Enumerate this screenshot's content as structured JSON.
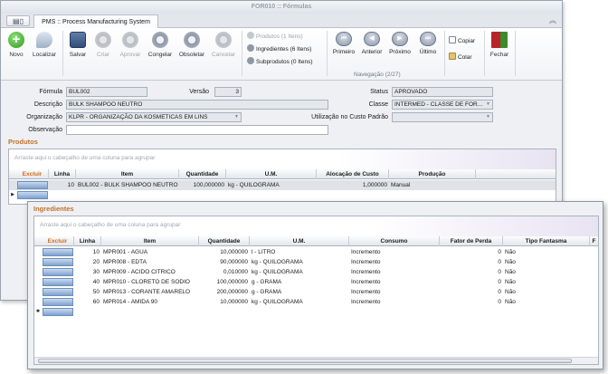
{
  "window": {
    "title": "FOR010 :: Fórmulas",
    "tab": "PMS :: Process Manufacturing System"
  },
  "toolbar": {
    "novo": "Novo",
    "localizar": "Localizar",
    "salvar": "Salvar",
    "criar": "Criar",
    "aprovar": "Aprovar",
    "congelar": "Congelar",
    "obsoletar": "Obsoletar",
    "cancelar": "Cancelar",
    "produtos": "Produtos (1 Itens)",
    "ingredientes": "Ingredientes (6 Itens)",
    "subprodutos": "Subprodutos (0 Itens)",
    "primeiro": "Primeiro",
    "anterior": "Anterior",
    "proximo": "Próximo",
    "ultimo": "Último",
    "navegacao": "Navegação (2/27)",
    "copiar": "Copiar",
    "colar": "Colar",
    "fechar": "Fechar"
  },
  "form": {
    "formula_label": "Fórmula",
    "formula_value": "BUL002",
    "versao_label": "Versão",
    "versao_value": "3",
    "descricao_label": "Descrição",
    "descricao_value": "BULK SHAMPOO NEUTRO",
    "organizacao_label": "Organização",
    "organizacao_value": "KLPR - ORGANIZAÇÃO DA KOSMETICAS EM LINS",
    "observacao_label": "Observação",
    "observacao_value": "",
    "status_label": "Status",
    "status_value": "APROVADO",
    "classe_label": "Classe",
    "classe_value": "INTERMED - CLASSE DE FOR...",
    "utilizacao_label": "Utilização no Custo Padrão",
    "utilizacao_value": ""
  },
  "produtos": {
    "title": "Produtos",
    "group_hint": "Arraste aqui o cabeçalho de uma coluna para agrupar",
    "columns": [
      "Excluir",
      "Linha",
      "Item",
      "Quantidade",
      "U.M.",
      "Alocação de Custo",
      "Produção"
    ],
    "rows": [
      {
        "linha": "10",
        "item": "BUL002 - BULK SHAMPOO NEUTRO",
        "quantidade": "100,000000",
        "um": "kg - QUILOGRAMA",
        "alocacao": "1,000000",
        "producao": "Manual"
      }
    ]
  },
  "ingredientes": {
    "title": "Ingredientes",
    "group_hint": "Arraste aqui o cabeçalho de uma coluna para agrupar",
    "columns": [
      "Excluir",
      "Linha",
      "Item",
      "Quantidade",
      "U.M.",
      "Consumo",
      "Fator de Perda",
      "Tipo Fantasma",
      "F"
    ],
    "rows": [
      {
        "linha": "10",
        "item": "MPR001 - AGUA",
        "quantidade": "10,000000",
        "um": "l - LITRO",
        "consumo": "Incremento",
        "fator": "0",
        "tipo": "Não"
      },
      {
        "linha": "20",
        "item": "MPR008 - EDTA",
        "quantidade": "90,000000",
        "um": "kg - QUILOGRAMA",
        "consumo": "Incremento",
        "fator": "0",
        "tipo": "Não"
      },
      {
        "linha": "30",
        "item": "MPR009 - ACIDO CITRICO",
        "quantidade": "0,010000",
        "um": "kg - QUILOGRAMA",
        "consumo": "Incremento",
        "fator": "0",
        "tipo": "Não"
      },
      {
        "linha": "40",
        "item": "MPR010 - CLORETO DE SODIO",
        "quantidade": "100,000000",
        "um": "g - GRAMA",
        "consumo": "Incremento",
        "fator": "0",
        "tipo": "Não"
      },
      {
        "linha": "50",
        "item": "MPR013 - CORANTE AMARELO",
        "quantidade": "200,000000",
        "um": "g - GRAMA",
        "consumo": "Incremento",
        "fator": "0",
        "tipo": "Não"
      },
      {
        "linha": "60",
        "item": "MPR014 - AMIDA 90",
        "quantidade": "10,000000",
        "um": "kg - QUILOGRAMA",
        "consumo": "Incremento",
        "fator": "0",
        "tipo": "Não"
      }
    ]
  }
}
